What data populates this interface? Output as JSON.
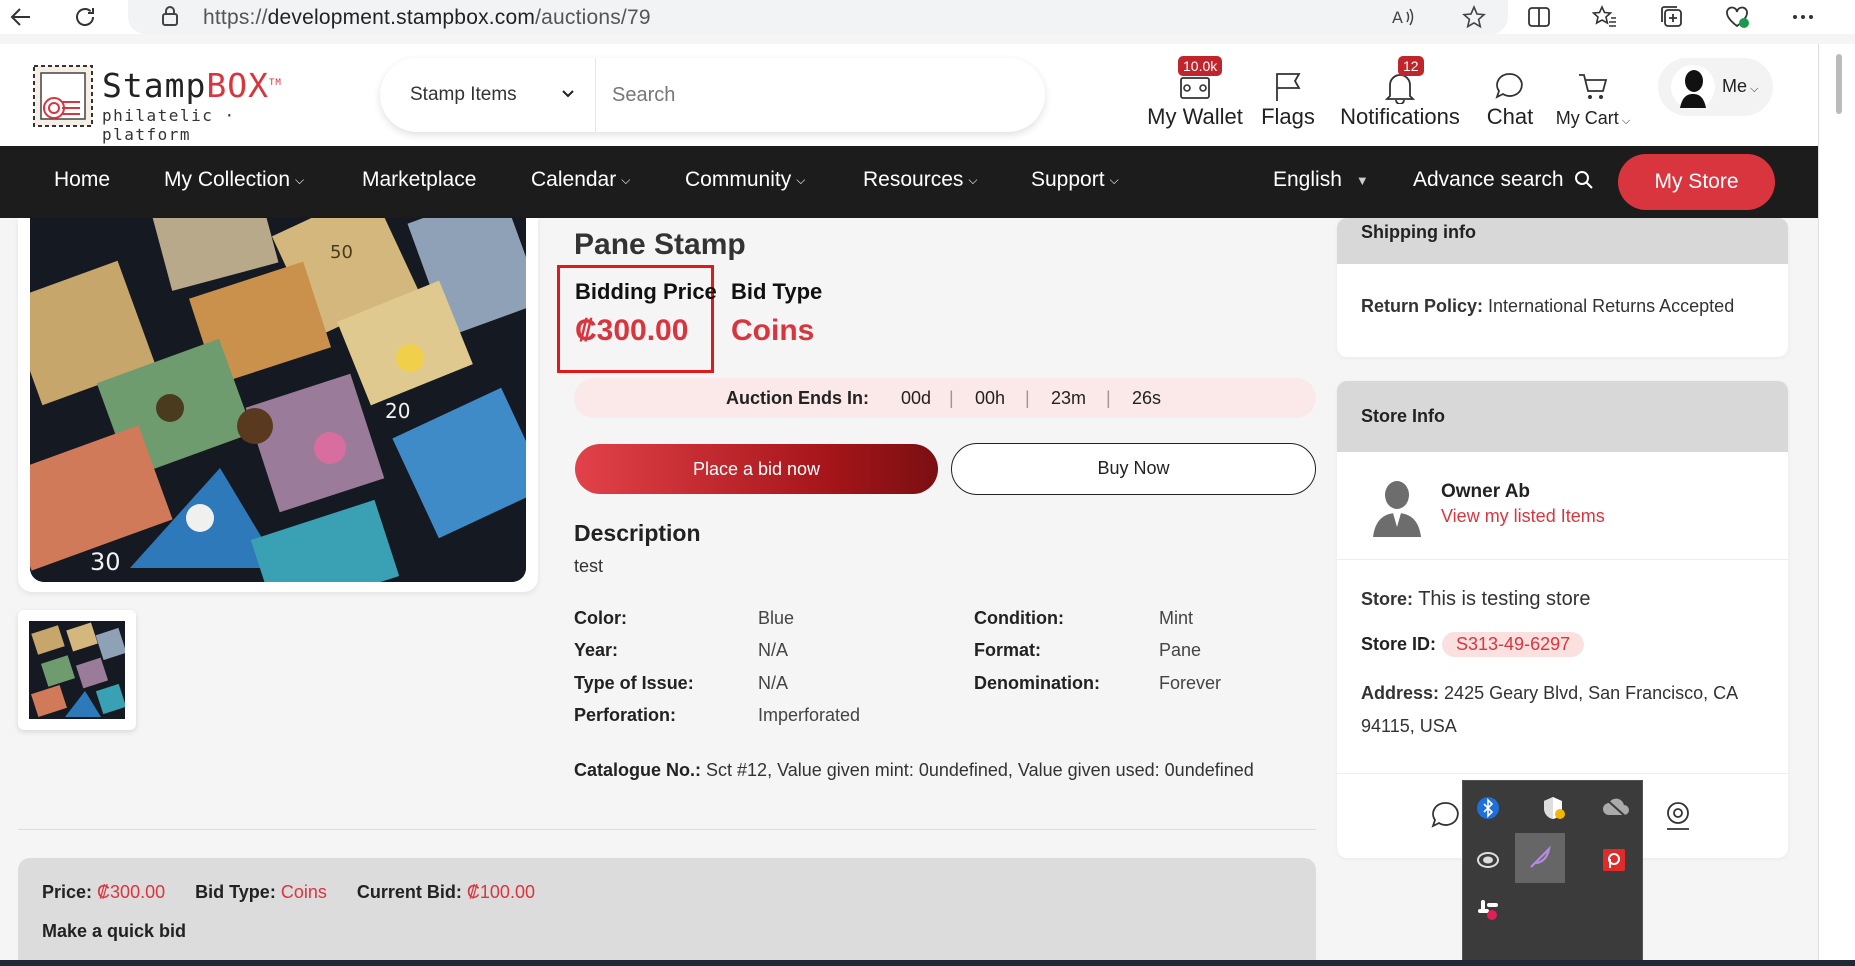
{
  "browser": {
    "url_prefix": "https://",
    "url_host": "development.stampbox.com",
    "url_path": "/auctions/79"
  },
  "brand": {
    "name_part1": "Stamp",
    "name_part2": "BOX",
    "tm": "TM",
    "tagline": "philatelic · platform"
  },
  "search": {
    "category": "Stamp Items",
    "placeholder": "Search"
  },
  "header": {
    "wallet_label": "My Wallet",
    "wallet_badge": "10.0k",
    "flags_label": "Flags",
    "notifications_label": "Notifications",
    "notifications_badge": "12",
    "chat_label": "Chat",
    "cart_label": "My Cart",
    "me_label": "Me"
  },
  "nav": {
    "items": [
      "Home",
      "My Collection",
      "Marketplace",
      "Calendar",
      "Community",
      "Resources",
      "Support"
    ],
    "language": "English",
    "advance_search": "Advance search",
    "my_store": "My Store"
  },
  "product": {
    "title": "Pane Stamp",
    "bidding_price_label": "Bidding Price",
    "bidding_price_value": "₡300.00",
    "bid_type_label": "Bid Type",
    "bid_type_value": "Coins",
    "auction_label": "Auction Ends In:",
    "days": "00d",
    "hours": "00h",
    "minutes": "23m",
    "seconds": "26s",
    "sep": "|",
    "place_bid": "Place a bid now",
    "buy_now": "Buy Now",
    "description_heading": "Description",
    "description_text": "test",
    "specs": [
      {
        "label": "Color:",
        "value": "Blue"
      },
      {
        "label": "Year:",
        "value": "N/A"
      },
      {
        "label": "Type of Issue:",
        "value": "N/A"
      },
      {
        "label": "Perforation:",
        "value": "Imperforated"
      },
      {
        "label": "Condition:",
        "value": "Mint"
      },
      {
        "label": "Format:",
        "value": "Pane"
      },
      {
        "label": "Denomination:",
        "value": "Forever"
      }
    ],
    "catalogue_label": "Catalogue No.:",
    "catalogue_value": "Sct #12, Value given mint: 0undefined, Value given used: 0undefined"
  },
  "bottom": {
    "price_label": "Price:",
    "price_value": "₡300.00",
    "bid_type_label": "Bid Type:",
    "bid_type_value": "Coins",
    "current_bid_label": "Current Bid:",
    "current_bid_value": "₡100.00",
    "quick_bid": "Make a quick bid"
  },
  "shipping": {
    "heading": "Shipping info",
    "return_label": "Return Policy:",
    "return_value": "International Returns Accepted"
  },
  "store": {
    "heading": "Store Info",
    "owner": "Owner Ab",
    "view_items": "View my listed Items",
    "store_label": "Store:",
    "store_value": "This is testing store",
    "id_label": "Store ID:",
    "id_value": "S313-49-6297",
    "address_label": "Address:",
    "address_line1": "2425 Geary Blvd, San Francisco, CA",
    "address_line2": "94115, USA"
  },
  "colors": {
    "accent": "#d9353f",
    "nav_bg": "#1c1c1c",
    "highlight_box": "#e01a1a"
  }
}
